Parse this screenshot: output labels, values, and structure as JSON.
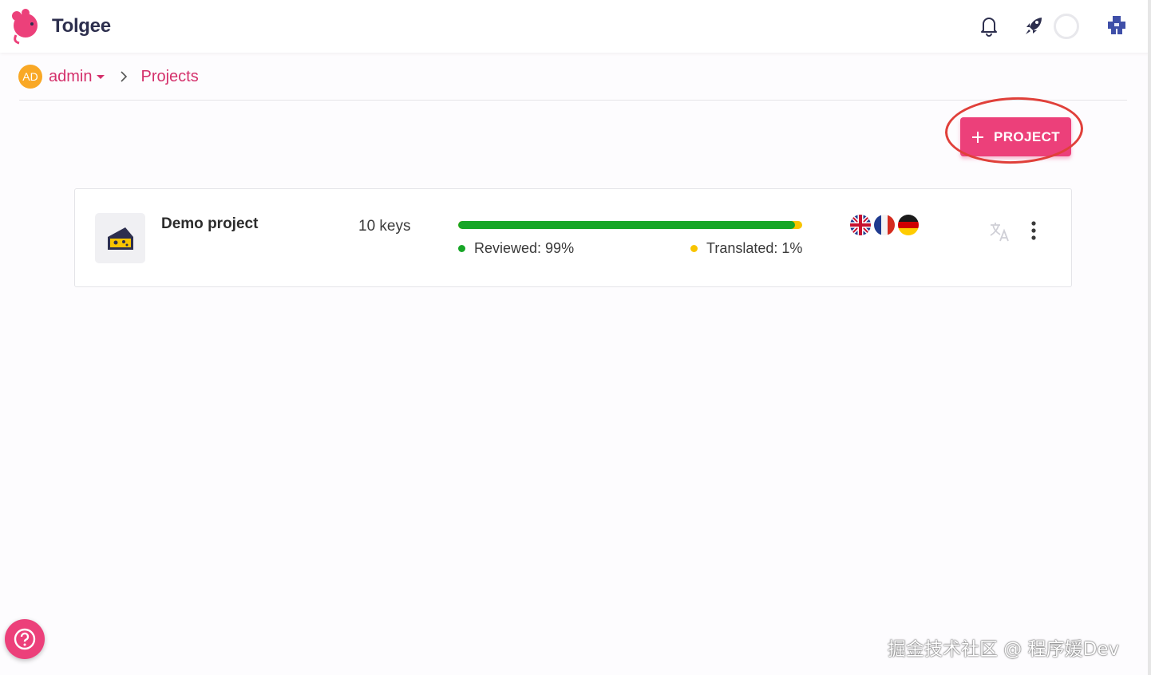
{
  "app": {
    "name": "Tolgee"
  },
  "breadcrumb": {
    "user_initials": "AD",
    "user": "admin",
    "projects": "Projects"
  },
  "toolbar": {
    "add_project_label": "PROJECT"
  },
  "projects": [
    {
      "name": "Demo project",
      "keys": "10 keys",
      "reviewed_fraction": 0.98,
      "reviewed_label": "Reviewed: 99%",
      "translated_label": "Translated: 1%",
      "languages": [
        "en",
        "fr",
        "de"
      ]
    }
  ],
  "colors": {
    "brand": "#ec407a",
    "reviewed": "#17a627",
    "translated": "#f8c400",
    "avatar": "#f9a825"
  },
  "icons": [
    "tolgee-logo-icon",
    "bell-icon",
    "rocket-icon",
    "user-menu-icon",
    "chevron-right-icon",
    "plus-icon",
    "cheese-icon",
    "flag-en-icon",
    "flag-fr-icon",
    "flag-de-icon",
    "translate-icon",
    "more-vert-icon",
    "help-icon"
  ],
  "watermark": "掘金技术社区 @ 程序媛Dev"
}
